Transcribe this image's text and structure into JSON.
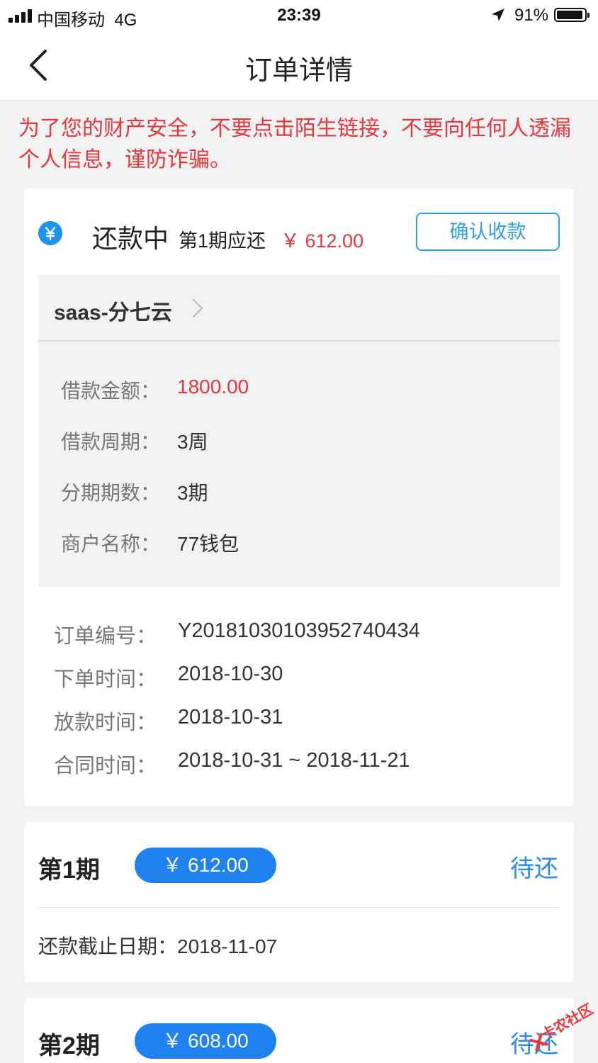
{
  "status_bar": {
    "carrier": "中国移动",
    "network": "4G",
    "time": "23:39",
    "battery": "91%"
  },
  "nav": {
    "title": "订单详情"
  },
  "warning": "为了您的财产安全，不要点击陌生链接，不要向任何人透漏个人信息，谨防诈骗。",
  "summary": {
    "status": "还款中",
    "period_due_label": "第1期应还",
    "due_amount": "￥ 612.00",
    "confirm_button": "确认收款"
  },
  "product": {
    "name": "saas-分七云"
  },
  "loan_info": [
    {
      "label": "借款金额：",
      "value": "1800.00"
    },
    {
      "label": "借款周期：",
      "value": "3周"
    },
    {
      "label": "分期期数：",
      "value": "3期"
    },
    {
      "label": "商户名称：",
      "value": "77钱包"
    }
  ],
  "order_info": [
    {
      "label": "订单编号：",
      "value": "Y20181030103952740434"
    },
    {
      "label": "下单时间：",
      "value": "2018-10-30"
    },
    {
      "label": "放款时间：",
      "value": "2018-10-31"
    },
    {
      "label": "合同时间：",
      "value": "2018-10-31 ~ 2018-11-21"
    }
  ],
  "periods": [
    {
      "label": "第1期",
      "amount": "￥ 612.00",
      "status": "待还",
      "deadline": "还款截止日期：2018-11-07"
    },
    {
      "label": "第2期",
      "amount": "￥ 608.00",
      "status": "待还"
    }
  ],
  "watermark": "卡农社区",
  "colors": {
    "accent_blue": "#1f82f0",
    "alert_red": "#e8383d",
    "outline_blue": "#2ea0e8"
  }
}
